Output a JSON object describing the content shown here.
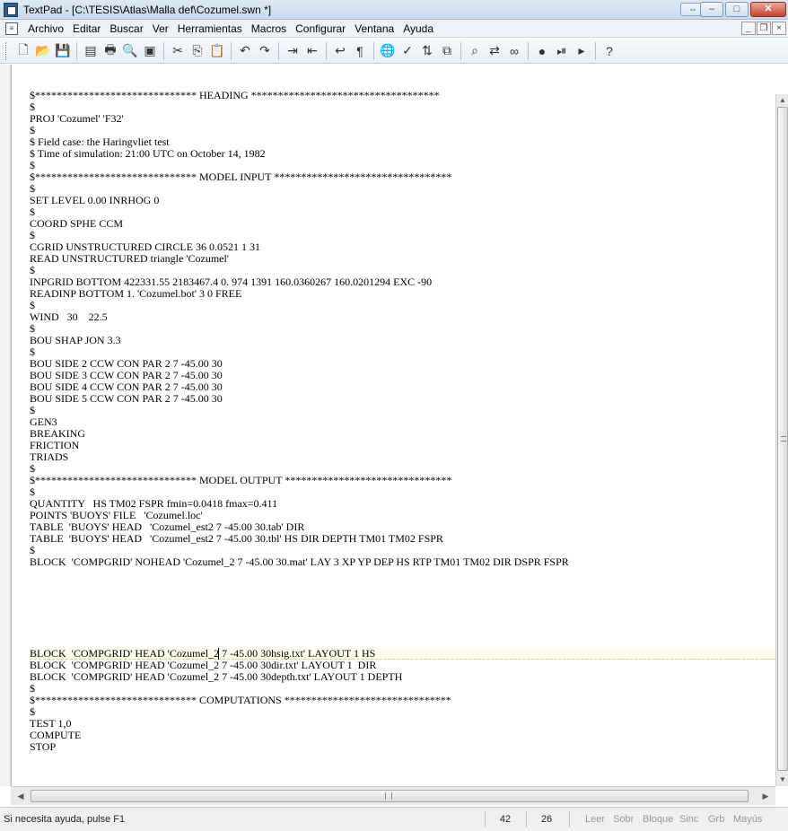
{
  "window": {
    "title": "TextPad - [C:\\TESIS\\Atlas\\Malla def\\Cozumel.swn *]"
  },
  "menubar": {
    "items": [
      "Archivo",
      "Editar",
      "Buscar",
      "Ver",
      "Herramientas",
      "Macros",
      "Configurar",
      "Ventana",
      "Ayuda"
    ]
  },
  "toolbar": {
    "icons": [
      "new-file-icon",
      "open-folder-icon",
      "save-icon",
      "document-properties-icon",
      "print-icon",
      "print-preview-icon",
      "manage-files-icon",
      "cut-icon",
      "copy-icon",
      "paste-icon",
      "undo-icon",
      "redo-icon",
      "indent-icon",
      "outdent-icon",
      "word-wrap-icon",
      "paragraph-icon",
      "web-icon",
      "spell-check-icon",
      "sort-icon",
      "compare-icon",
      "find-icon",
      "replace-icon",
      "binoculars-icon",
      "record-macro-icon",
      "play-macro-icon",
      "play-icon",
      "help-icon"
    ]
  },
  "editor": {
    "lines": [
      "$****************************** HEADING ***********************************",
      "$",
      "PROJ 'Cozumel' 'F32'",
      "$",
      "$ Field case: the Haringvliet test",
      "$ Time of simulation: 21:00 UTC on October 14, 1982",
      "$",
      "$****************************** MODEL INPUT *********************************",
      "$",
      "SET LEVEL 0.00 INRHOG 0",
      "$",
      "COORD SPHE CCM",
      "$",
      "CGRID UNSTRUCTURED CIRCLE 36 0.0521 1 31",
      "READ UNSTRUCTURED triangle 'Cozumel'",
      "$",
      "INPGRID BOTTOM 422331.55 2183467.4 0. 974 1391 160.0360267 160.0201294 EXC -90",
      "READINP BOTTOM 1. 'Cozumel.bot' 3 0 FREE",
      "$",
      "WIND   30    22.5",
      "$",
      "BOU SHAP JON 3.3",
      "$",
      "BOU SIDE 2 CCW CON PAR 2 7 -45.00 30",
      "BOU SIDE 3 CCW CON PAR 2 7 -45.00 30",
      "BOU SIDE 4 CCW CON PAR 2 7 -45.00 30",
      "BOU SIDE 5 CCW CON PAR 2 7 -45.00 30",
      "$",
      "GEN3",
      "BREAKING",
      "FRICTION",
      "TRIADS",
      "$",
      "$****************************** MODEL OUTPUT *******************************",
      "$",
      "QUANTITY   HS TM02 FSPR fmin=0.0418 fmax=0.411",
      "POINTS 'BUOYS' FILE   'Cozumel.loc'",
      "TABLE  'BUOYS' HEAD   'Cozumel_est2 7 -45.00 30.tab' DIR",
      "TABLE  'BUOYS' HEAD   'Cozumel_est2 7 -45.00 30.tbl' HS DIR DEPTH TM01 TM02 FSPR",
      "$",
      "BLOCK  'COMPGRID' NOHEAD 'Cozumel_2 7 -45.00 30.mat' LAY 3 XP YP DEP HS RTP TM01 TM02 DIR DSPR FSPR",
      "BLOCK  'COMPGRID' HEAD 'Cozumel_2 7 -45.00 30hsig.txt' LAYOUT 1 HS",
      "BLOCK  'COMPGRID' HEAD 'Cozumel_2 7 -45.00 30dir.txt' LAYOUT 1  DIR",
      "BLOCK  'COMPGRID' HEAD 'Cozumel_2 7 -45.00 30depth.txt' LAYOUT 1 DEPTH",
      "$",
      "$****************************** COMPUTATIONS *******************************",
      "$",
      "TEST 1,0",
      "COMPUTE",
      "STOP"
    ]
  },
  "statusbar": {
    "help_text": "Si necesita ayuda, pulse F1",
    "line": "42",
    "column": "26",
    "flags": [
      "Leer",
      "Sobr",
      "Bloque",
      "Sinc",
      "Grb",
      "Mayús"
    ]
  }
}
